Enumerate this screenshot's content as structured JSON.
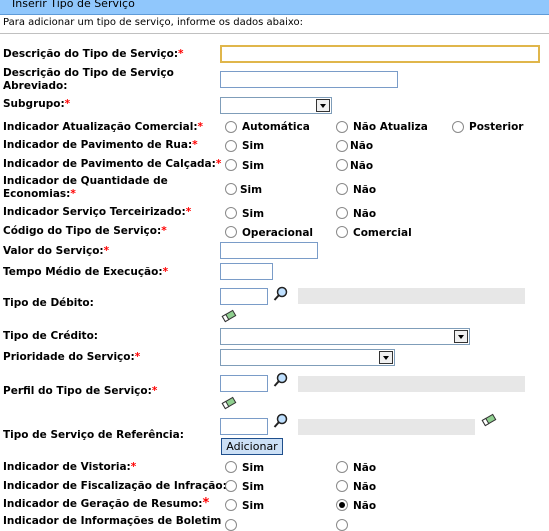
{
  "header": {
    "title": "Inserir Tipo de Serviço",
    "subtitle": "Para adicionar um tipo de serviço, informe os dados abaixo:"
  },
  "fields": {
    "descricao": "Descrição do Tipo de Serviço:",
    "descricao_abrev_1": "Descrição do Tipo de Serviço",
    "descricao_abrev_2": "Abreviado:",
    "subgrupo": "Subgrupo:",
    "ind_atualizacao": "Indicador Atualização Comercial:",
    "ind_pav_rua": "Indicador de Pavimento de Rua:",
    "ind_pav_calcada": "Indicador de Pavimento de Calçada:",
    "ind_qtd_1": "Indicador de Quantidade de",
    "ind_qtd_2": "Economias:",
    "ind_terceirizado": "Indicador Serviço Terceirizado:",
    "codigo_tipo": "Código do Tipo de Serviço:",
    "valor": "Valor do Serviço:",
    "tempo_medio": "Tempo Médio de Execução:",
    "tipo_debito": "Tipo de Débito:",
    "tipo_credito": "Tipo de Crédito:",
    "prioridade": "Prioridade do Serviço:",
    "perfil": "Perfil do Tipo de Serviço:",
    "tipo_referencia": "Tipo de Serviço de Referência:",
    "ind_vistoria": "Indicador de Vistoria:",
    "ind_fiscalizacao": "Indicador de Fiscalização de Infração:",
    "ind_geracao": "Indicador de Geração de Resumo:",
    "ind_boletim": "Indicador de Informações de Boletim"
  },
  "required_mark": "*",
  "options": {
    "automatica": "Automática",
    "nao_atualiza": "Não Atualiza",
    "posterior": "Posterior",
    "sim": "Sim",
    "nao": "Não",
    "operacional": "Operacional",
    "comercial": "Comercial"
  },
  "buttons": {
    "adicionar": "Adicionar"
  },
  "state": {
    "ind_geracao_selected": "Não"
  }
}
